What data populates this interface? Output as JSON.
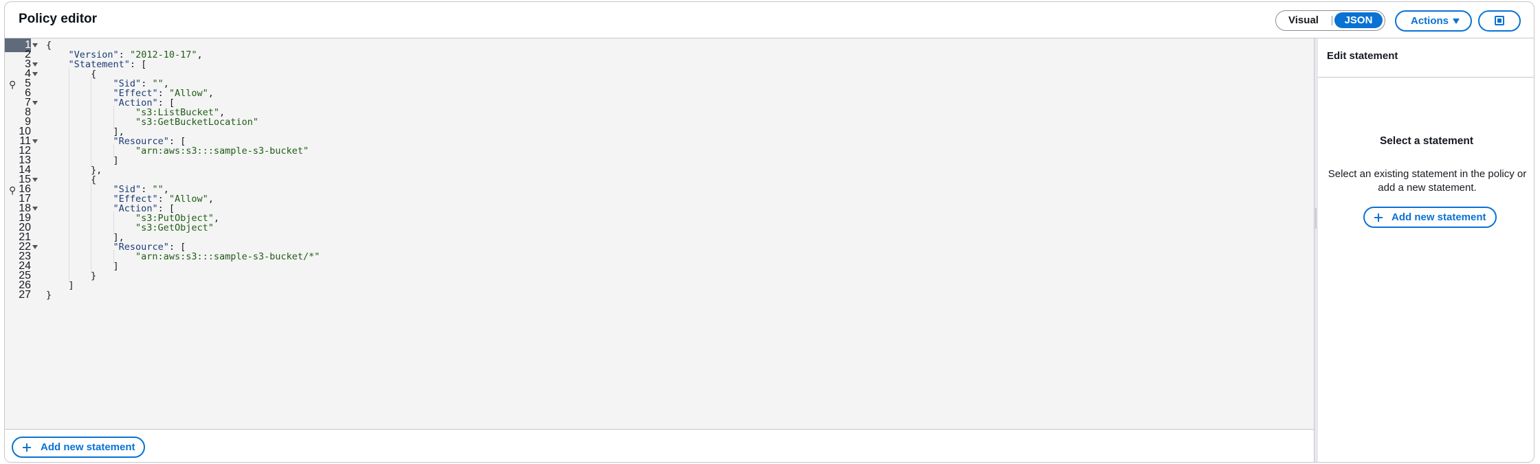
{
  "header": {
    "title": "Policy editor",
    "view_toggle": {
      "options": [
        "Visual",
        "JSON"
      ],
      "selected": "JSON"
    },
    "actions_label": "Actions"
  },
  "editor": {
    "active_line": 1,
    "lines": [
      {
        "n": "1",
        "text": "{"
      },
      {
        "n": "2",
        "text": "    \"Version\": \"2012-10-17\","
      },
      {
        "n": "3",
        "text": "    \"Statement\": ["
      },
      {
        "n": "4",
        "text": "        {"
      },
      {
        "n": "5",
        "text": "            \"Sid\": \"\","
      },
      {
        "n": "6",
        "text": "            \"Effect\": \"Allow\","
      },
      {
        "n": "7",
        "text": "            \"Action\": ["
      },
      {
        "n": "8",
        "text": "                \"s3:ListBucket\","
      },
      {
        "n": "9",
        "text": "                \"s3:GetBucketLocation\""
      },
      {
        "n": "10",
        "text": "            ],"
      },
      {
        "n": "11",
        "text": "            \"Resource\": ["
      },
      {
        "n": "12",
        "text": "                \"arn:aws:s3:::sample-s3-bucket\""
      },
      {
        "n": "13",
        "text": "            ]"
      },
      {
        "n": "14",
        "text": "        },"
      },
      {
        "n": "15",
        "text": "        {"
      },
      {
        "n": "16",
        "text": "            \"Sid\": \"\","
      },
      {
        "n": "17",
        "text": "            \"Effect\": \"Allow\","
      },
      {
        "n": "18",
        "text": "            \"Action\": ["
      },
      {
        "n": "19",
        "text": "                \"s3:PutObject\","
      },
      {
        "n": "20",
        "text": "                \"s3:GetObject\""
      },
      {
        "n": "21",
        "text": "            ],"
      },
      {
        "n": "22",
        "text": "            \"Resource\": ["
      },
      {
        "n": "23",
        "text": "                \"arn:aws:s3:::sample-s3-bucket/*\""
      },
      {
        "n": "24",
        "text": "            ]"
      },
      {
        "n": "25",
        "text": "        }"
      },
      {
        "n": "26",
        "text": "    ]"
      },
      {
        "n": "27",
        "text": "}"
      }
    ],
    "foldable_lines": [
      1,
      3,
      4,
      7,
      11,
      15,
      18,
      22
    ],
    "lightbulb_lines": [
      5,
      16
    ]
  },
  "footer": {
    "add_statement_label": "Add new statement"
  },
  "side_panel": {
    "title": "Edit statement",
    "empty_title": "Select a statement",
    "empty_description": "Select an existing statement in the policy or add a new statement.",
    "add_statement_label": "Add new statement"
  },
  "colors": {
    "accent": "#0972d3",
    "json_key": "#1c3b75",
    "json_string": "#1f5d16",
    "editor_bg": "#f4f4f4"
  },
  "icons": [
    "chevron-down-icon",
    "split-panel-icon",
    "plus-icon",
    "lightbulb-icon",
    "fold-arrow-icon"
  ]
}
